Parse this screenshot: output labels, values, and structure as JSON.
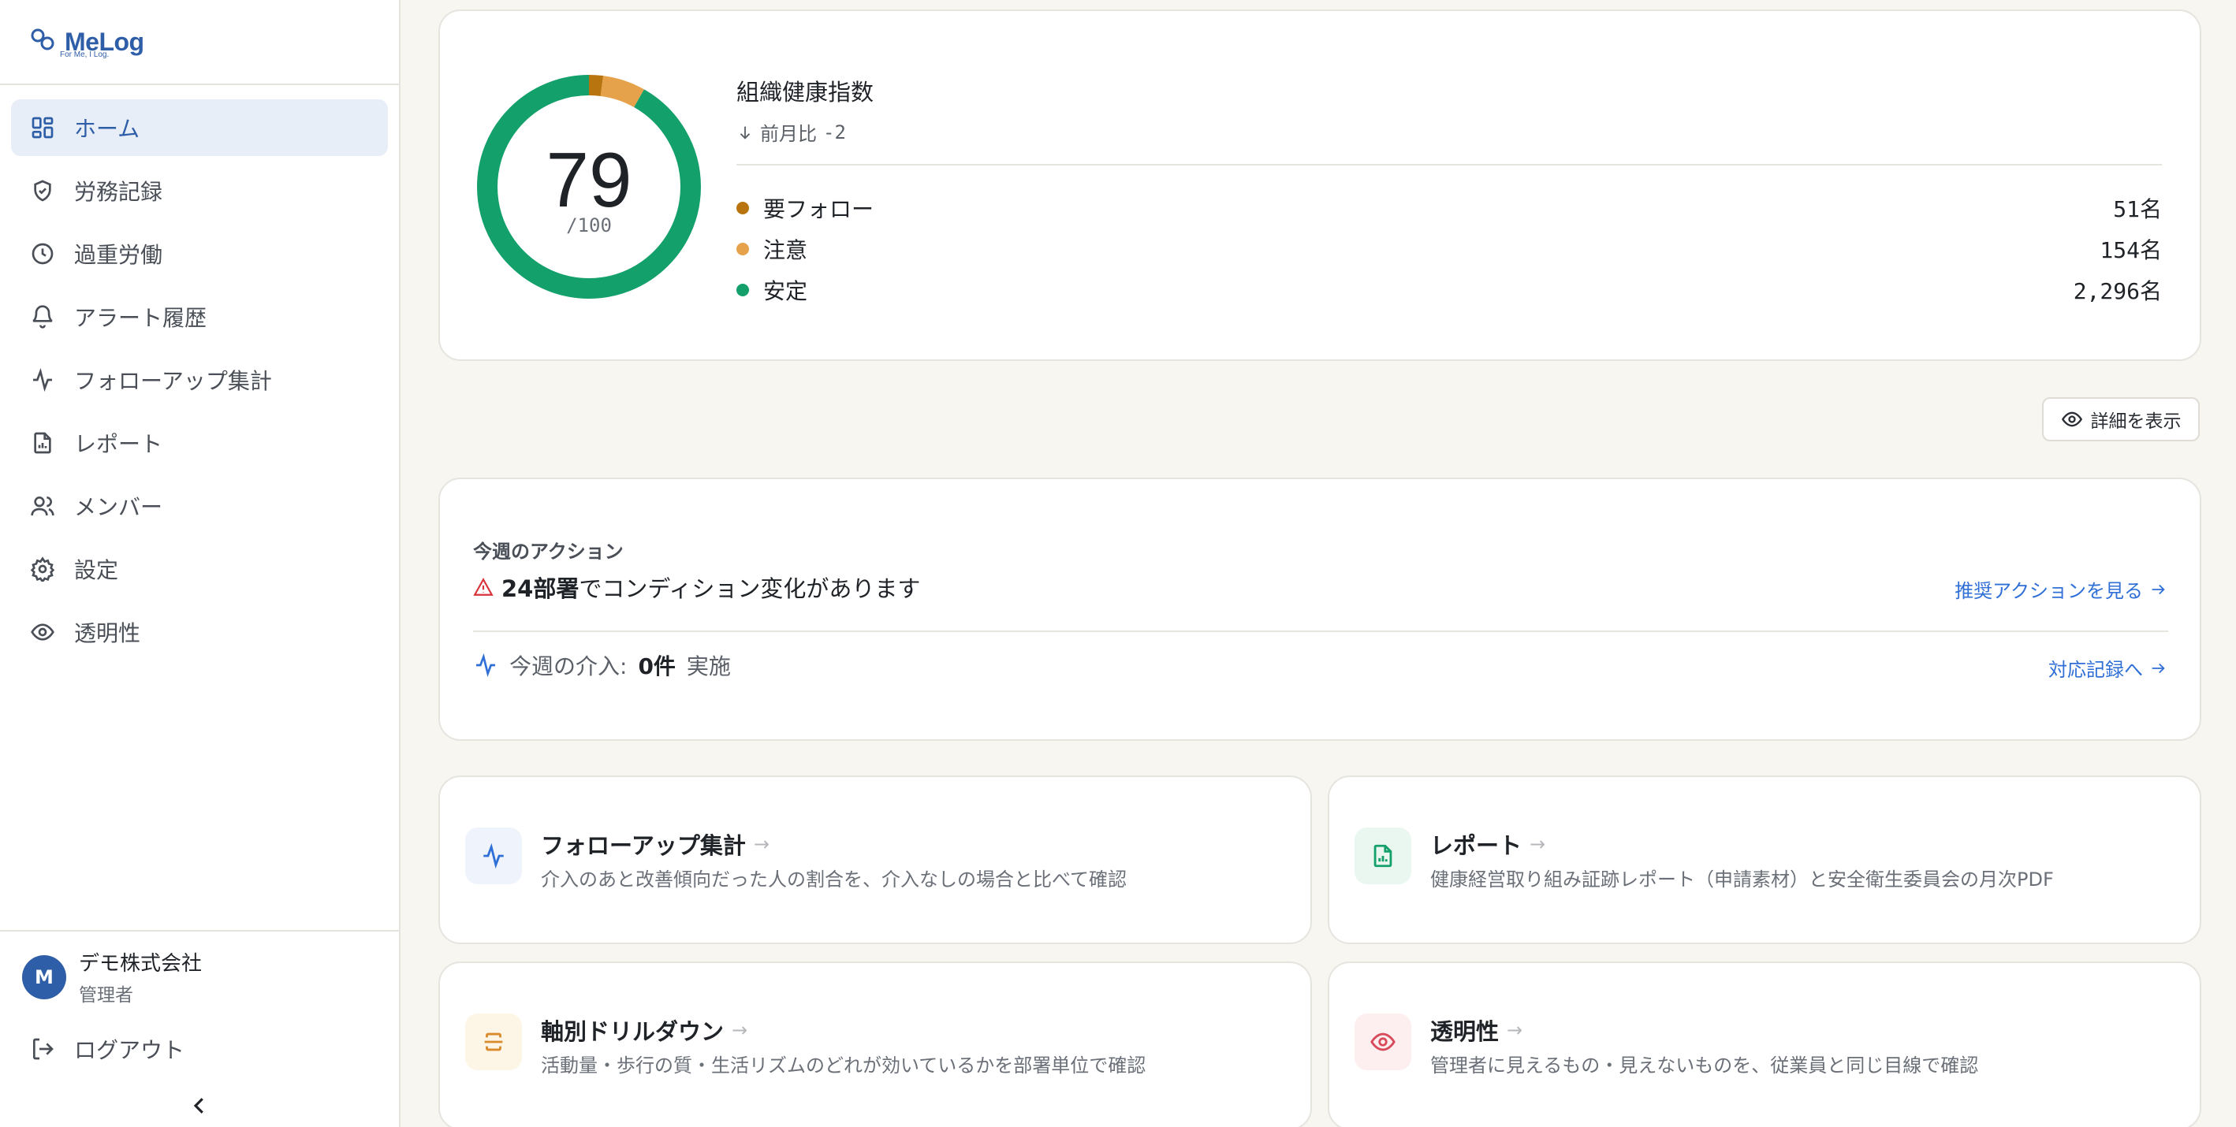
{
  "brand": {
    "name": "MeLog",
    "tagline": "For Me, I Log."
  },
  "sidebar": {
    "items": [
      {
        "label": "ホーム",
        "icon": "dashboard-icon",
        "active": true
      },
      {
        "label": "労務記録",
        "icon": "shield-check-icon"
      },
      {
        "label": "過重労働",
        "icon": "clock-icon"
      },
      {
        "label": "アラート履歴",
        "icon": "bell-icon"
      },
      {
        "label": "フォローアップ集計",
        "icon": "activity-icon"
      },
      {
        "label": "レポート",
        "icon": "file-chart-icon"
      },
      {
        "label": "メンバー",
        "icon": "users-icon"
      },
      {
        "label": "設定",
        "icon": "gear-icon"
      },
      {
        "label": "透明性",
        "icon": "eye-icon"
      }
    ],
    "profile": {
      "initial": "M",
      "name": "デモ株式会社",
      "role": "管理者"
    },
    "logout_label": "ログアウト"
  },
  "health": {
    "score": "79",
    "max": "/100",
    "title": "組織健康指数",
    "delta_label": "前月比",
    "delta_value": "-2",
    "legend": [
      {
        "label": "要フォロー",
        "value": "51名",
        "color": "#b8740f"
      },
      {
        "label": "注意",
        "value": "154名",
        "color": "#e6a24a"
      },
      {
        "label": "安定",
        "value": "2,296名",
        "color": "#13a06b"
      }
    ]
  },
  "detail_button": "詳細を表示",
  "actions": {
    "heading": "今週のアクション",
    "condition_count": "24部署",
    "condition_text": "でコンディション変化があります",
    "condition_link": "推奨アクションを見る",
    "intervention_label": "今週の介入:",
    "intervention_count": "0件",
    "intervention_suffix": "実施",
    "intervention_link": "対応記録へ"
  },
  "tiles": [
    {
      "title": "フォローアップ集計",
      "desc": "介入のあと改善傾向だった人の割合を、介入なしの場合と比べて確認",
      "icon": "activity-icon",
      "accent": "#2f6fd6"
    },
    {
      "title": "レポート",
      "desc": "健康経営取り組み証跡レポート（申請素材）と安全衛生委員会の月次PDF",
      "icon": "file-chart-icon",
      "accent": "#13a06b"
    },
    {
      "title": "軸別ドリルダウン",
      "desc": "活動量・歩行の質・生活リズムのどれが効いているかを部署単位で確認",
      "icon": "split-icon",
      "accent": "#d98a2b"
    },
    {
      "title": "透明性",
      "desc": "管理者に見えるもの・見えないものを、従業員と同じ目線で確認",
      "icon": "eye-icon",
      "accent": "#d84a5a"
    }
  ],
  "colors": {
    "accent": "#2f5ea8",
    "link": "#2f6fd6",
    "follow": "#b8740f",
    "caution": "#e6a24a",
    "stable": "#13a06b"
  },
  "chart_data": {
    "type": "pie",
    "categories": [
      "要フォロー",
      "注意",
      "安定"
    ],
    "values": [
      51,
      154,
      2296
    ]
  }
}
